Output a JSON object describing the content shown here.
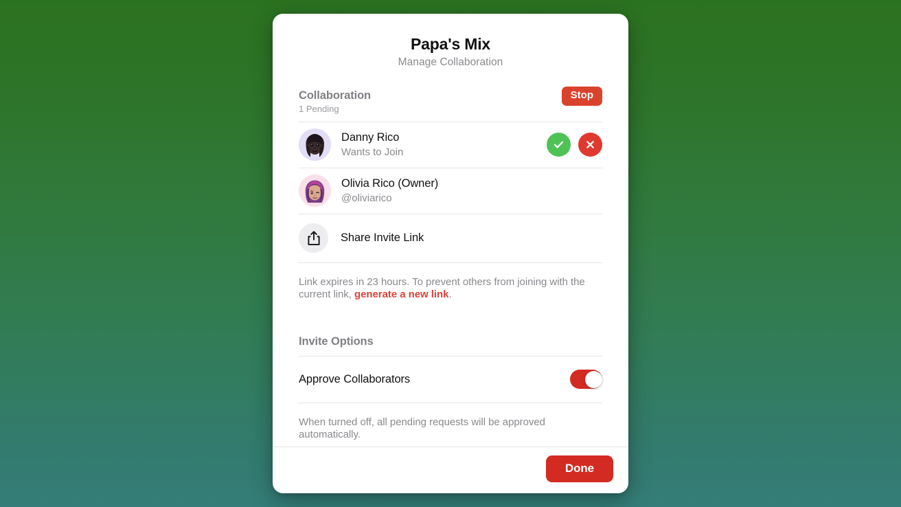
{
  "card": {
    "title": "Papa's Mix",
    "subtitle": "Manage Collaboration"
  },
  "collaboration": {
    "section_title": "Collaboration",
    "section_sub": "1 Pending",
    "stop_label": "Stop",
    "people": [
      {
        "name": "Danny Rico",
        "sub": "Wants to Join",
        "avatar_bg": "#e3dcf5",
        "accept_label": "Accept",
        "reject_label": "Reject"
      },
      {
        "name": "Olivia Rico (Owner)",
        "sub": "@oliviarico",
        "avatar_bg": "#fadfe9"
      }
    ]
  },
  "share": {
    "label": "Share Invite Link",
    "icon": "share-icon"
  },
  "link_note": {
    "prefix": "Link expires in 23 hours. To prevent others from joining with the current link, ",
    "link_text": "generate a new link",
    "suffix": "."
  },
  "invite_options": {
    "title": "Invite Options",
    "toggle_label": "Approve Collaborators",
    "toggle_state": "on",
    "footnote": "When turned off, all pending requests will be approved automatically."
  },
  "footer": {
    "done_label": "Done"
  },
  "colors": {
    "danger": "#d32b22",
    "stop": "#d9432c",
    "accept": "#4fc255",
    "reject": "#e0392f",
    "link": "#d9433a",
    "bg_top": "#2b7220",
    "bg_bottom": "#347d78"
  }
}
